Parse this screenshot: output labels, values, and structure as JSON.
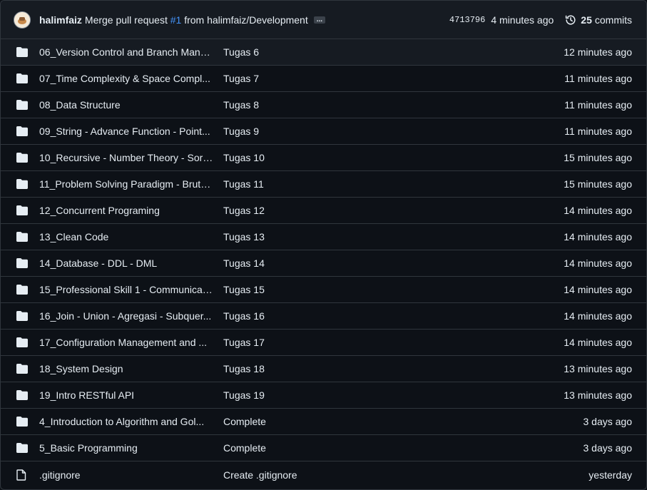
{
  "header": {
    "author": "halimfaiz",
    "message_prefix": "Merge pull request",
    "pr_number": "#1",
    "message_suffix": "from halimfaiz/Development",
    "ellipsis": "...",
    "sha": "4713796",
    "time_ago": "4 minutes ago",
    "commits_count": "25",
    "commits_label": "commits"
  },
  "rows": [
    {
      "type": "dir",
      "name": "06_Version Control and Branch Mana...",
      "message": "Tugas 6",
      "age": "12 minutes ago"
    },
    {
      "type": "dir",
      "name": "07_Time Complexity & Space Compl...",
      "message": "Tugas 7",
      "age": "11 minutes ago"
    },
    {
      "type": "dir",
      "name": "08_Data Structure",
      "message": "Tugas 8",
      "age": "11 minutes ago"
    },
    {
      "type": "dir",
      "name": "09_String - Advance Function - Point...",
      "message": "Tugas 9",
      "age": "11 minutes ago"
    },
    {
      "type": "dir",
      "name": "10_Recursive - Number Theory - Sort...",
      "message": "Tugas 10",
      "age": "15 minutes ago"
    },
    {
      "type": "dir",
      "name": "11_Problem Solving Paradigm - Brute...",
      "message": "Tugas 11",
      "age": "15 minutes ago"
    },
    {
      "type": "dir",
      "name": "12_Concurrent Programing",
      "message": "Tugas 12",
      "age": "14 minutes ago"
    },
    {
      "type": "dir",
      "name": "13_Clean Code",
      "message": "Tugas 13",
      "age": "14 minutes ago"
    },
    {
      "type": "dir",
      "name": "14_Database - DDL - DML",
      "message": "Tugas 14",
      "age": "14 minutes ago"
    },
    {
      "type": "dir",
      "name": "15_Professional Skill 1 - Communicati...",
      "message": "Tugas 15",
      "age": "14 minutes ago"
    },
    {
      "type": "dir",
      "name": "16_Join - Union - Agregasi - Subquer...",
      "message": "Tugas 16",
      "age": "14 minutes ago"
    },
    {
      "type": "dir",
      "name": "17_Configuration Management and ...",
      "message": "Tugas 17",
      "age": "14 minutes ago"
    },
    {
      "type": "dir",
      "name": "18_System Design",
      "message": "Tugas 18",
      "age": "13 minutes ago"
    },
    {
      "type": "dir",
      "name": "19_Intro RESTful API",
      "message": "Tugas 19",
      "age": "13 minutes ago"
    },
    {
      "type": "dir",
      "name": "4_Introduction to Algorithm and Gol...",
      "message": "Complete",
      "age": "3 days ago"
    },
    {
      "type": "dir",
      "name": "5_Basic Programming",
      "message": "Complete",
      "age": "3 days ago"
    },
    {
      "type": "file",
      "name": ".gitignore",
      "message": "Create .gitignore",
      "age": "yesterday"
    }
  ],
  "colors": {
    "background": "#0d1117",
    "header_bg": "#161b22",
    "border": "#30363d",
    "link": "#4493f8",
    "text": "#e6edf3"
  },
  "icons": {
    "dir": "folder-icon",
    "file": "file-icon",
    "history": "history-icon"
  }
}
